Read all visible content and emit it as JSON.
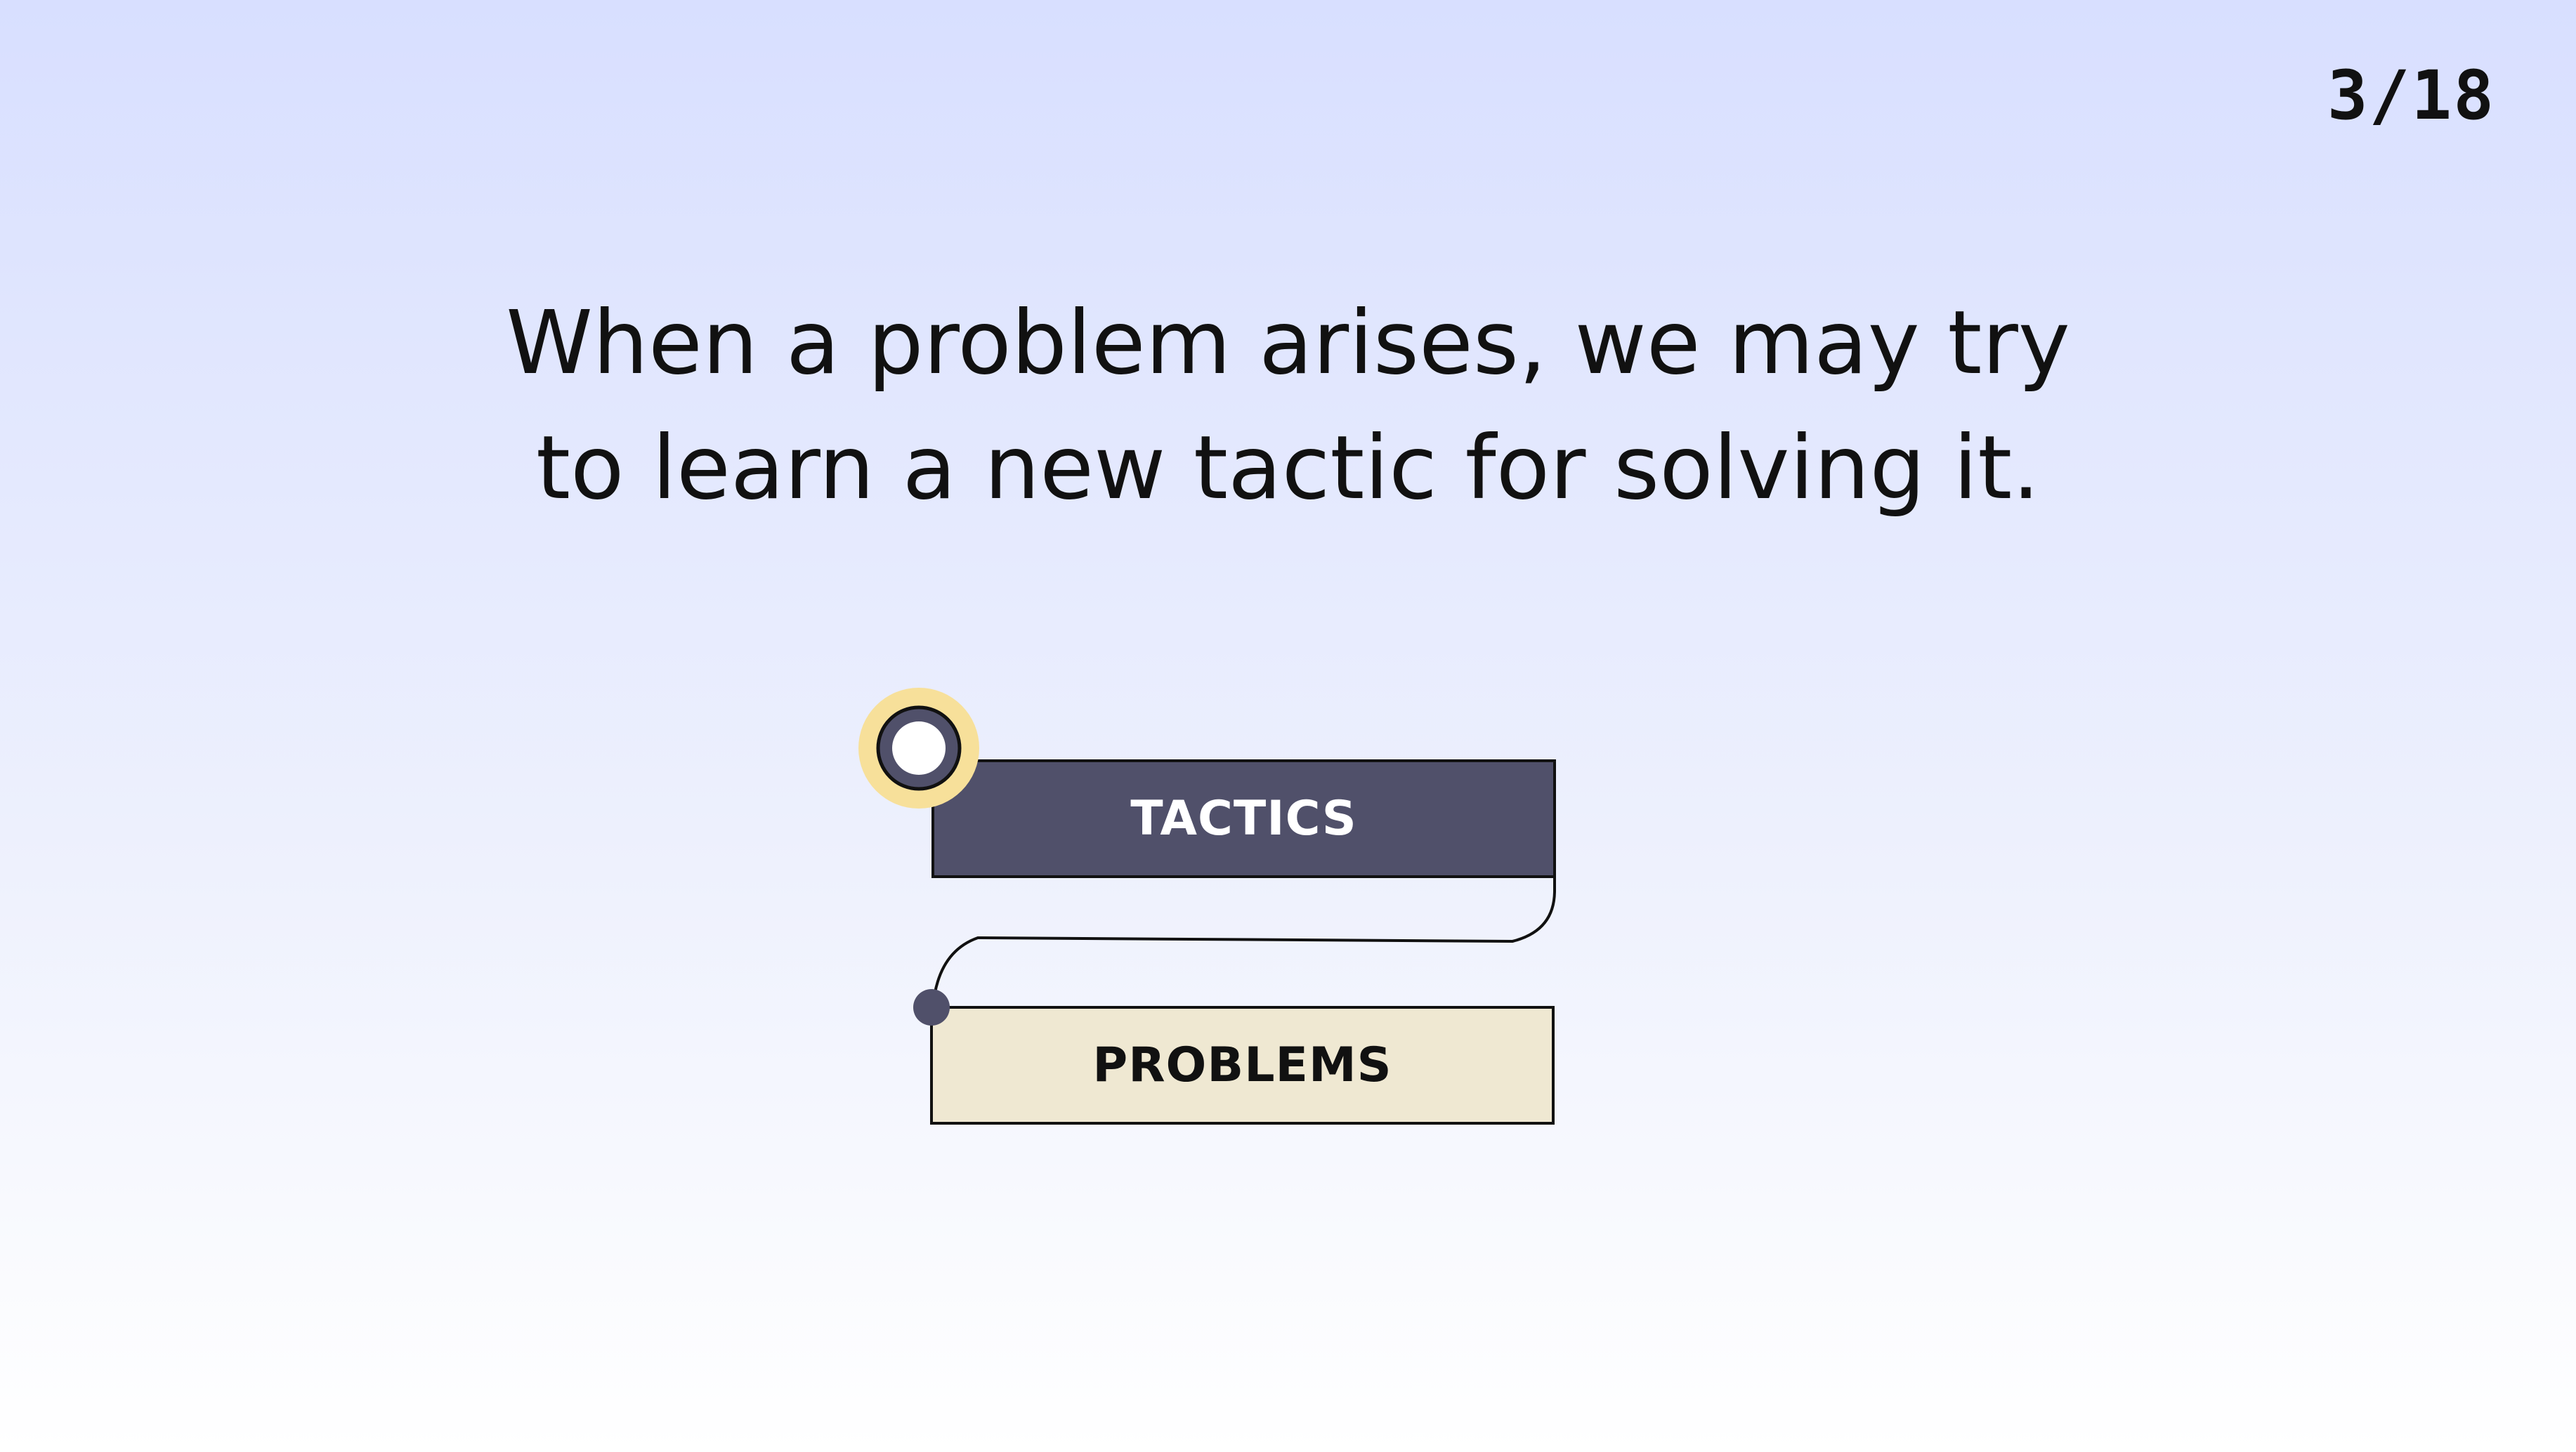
{
  "slide": {
    "counter": "3/18",
    "headline_line_1": "When a problem arises, we may try",
    "headline_line_2": "to learn a new tactic for solving it."
  },
  "diagram": {
    "tactics_label": "TACTICS",
    "problems_label": "PROBLEMS"
  },
  "colors": {
    "tactics_fill": "#50506a",
    "problems_fill": "#efe8d2",
    "highlight_halo": "#f7e09a",
    "outline": "#111111"
  }
}
